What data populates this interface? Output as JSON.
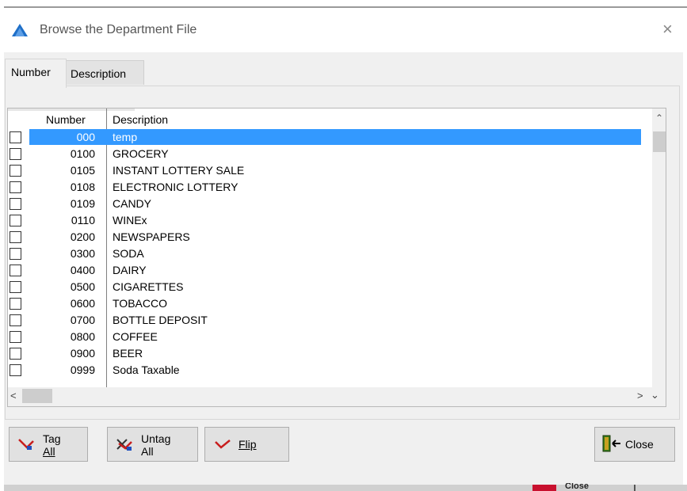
{
  "window": {
    "title": "Browse the Department File",
    "close_glyph": "×"
  },
  "tabs": [
    {
      "label": "Number",
      "active": true
    },
    {
      "label": "Description",
      "active": false
    }
  ],
  "grid": {
    "columns": [
      "Number",
      "Description"
    ],
    "rows": [
      {
        "number": "000",
        "description": "temp",
        "selected": true,
        "checked": false
      },
      {
        "number": "0100",
        "description": "GROCERY",
        "checked": false
      },
      {
        "number": "0105",
        "description": "INSTANT LOTTERY SALE",
        "checked": false
      },
      {
        "number": "0108",
        "description": "ELECTRONIC LOTTERY",
        "checked": false
      },
      {
        "number": "0109",
        "description": "CANDY",
        "checked": false
      },
      {
        "number": "0110",
        "description": "WINEx",
        "checked": false
      },
      {
        "number": "0200",
        "description": "NEWSPAPERS",
        "checked": false
      },
      {
        "number": "0300",
        "description": "SODA",
        "checked": false
      },
      {
        "number": "0400",
        "description": "DAIRY",
        "checked": false
      },
      {
        "number": "0500",
        "description": "CIGARETTES",
        "checked": false
      },
      {
        "number": "0600",
        "description": "TOBACCO",
        "checked": false
      },
      {
        "number": "0700",
        "description": "BOTTLE DEPOSIT",
        "checked": false
      },
      {
        "number": "0800",
        "description": "COFFEE",
        "checked": false
      },
      {
        "number": "0900",
        "description": "BEER",
        "checked": false
      },
      {
        "number": "0999",
        "description": "Soda Taxable",
        "checked": false
      }
    ]
  },
  "buttons": {
    "tag_all": {
      "line1": "Tag",
      "line2": "All",
      "icon": "tag-icon"
    },
    "untag_all": {
      "line1": "Untag",
      "line2": "All",
      "icon": "untag-icon"
    },
    "flip": {
      "label": "Flip",
      "icon": "flip-icon"
    },
    "close": {
      "label": "Close",
      "icon": "door-exit-icon"
    }
  },
  "taskbar": {
    "text": "Close"
  },
  "colors": {
    "selection": "#3399ff",
    "accent": "#1f6fc8",
    "button_face": "#e1e1e1"
  }
}
